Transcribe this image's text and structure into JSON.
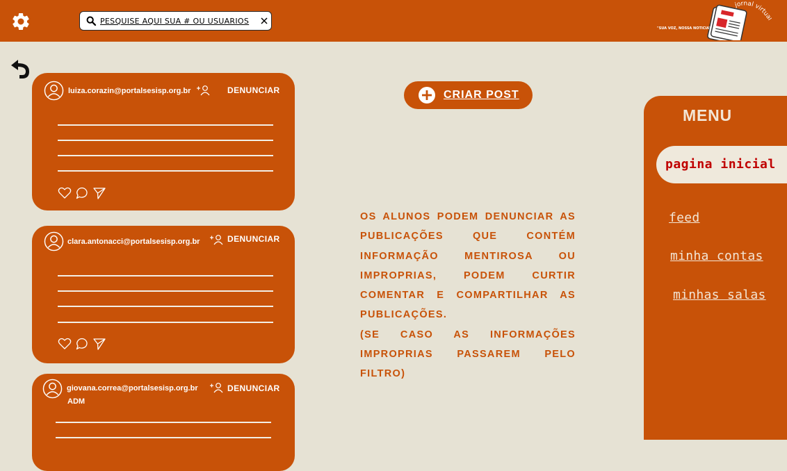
{
  "header": {
    "search_placeholder": "PESQUISE AQUI SUA # OU USUARIOS",
    "logo_top_text": "jornal virtual",
    "logo_slogan": "\"SUA VOZ, NOSSA NOTICIA\""
  },
  "posts": [
    {
      "email": "luiza.corazin@portalsesisp.org.br",
      "report_label": "DENUNCIAR",
      "role": ""
    },
    {
      "email": "clara.antonacci@portalsesisp.org.br",
      "report_label": "DENUNCIAR",
      "role": ""
    },
    {
      "email": "giovana.correa@portalsesisp.org.br",
      "report_label": "DENUNCIAR",
      "role": "ADM"
    }
  ],
  "create_post_label": "CRIAR POST",
  "info": {
    "paragraph1": "OS ALUNOS PODEM DENUNCIAR AS PUBLICAÇÕES QUE CONTÉM INFORMAÇÃO MENTIROSA OU IMPROPRIAS, PODEM CURTIR COMENTAR E COMPARTILHAR AS PUBLICAÇÕES.",
    "paragraph2": "(SE CASO AS INFORMAÇÕES IMPROPRIAS PASSAREM PELO FILTRO)"
  },
  "menu": {
    "title": "MENU",
    "active_item": "pagina inicial",
    "items": [
      "feed",
      "minha contas",
      "minhas salas"
    ]
  },
  "colors": {
    "primary": "#c85208",
    "background": "#e6e2d4",
    "active_text": "#c00000"
  }
}
